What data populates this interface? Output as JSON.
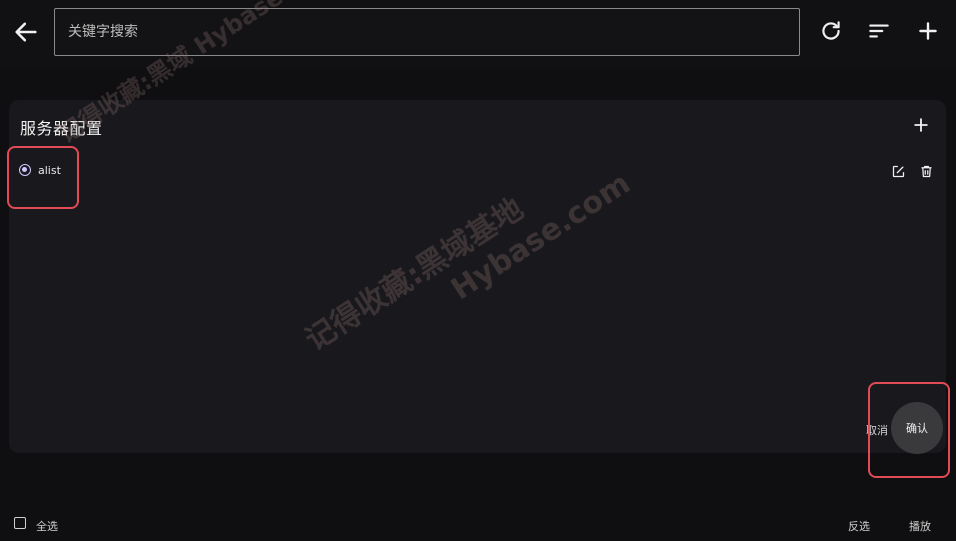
{
  "toolbar": {
    "search_placeholder": "关键字搜索"
  },
  "dialog": {
    "title": "服务器配置",
    "servers": [
      {
        "label": "alist",
        "selected": true
      }
    ],
    "cancel_label": "取消",
    "confirm_label": "确认"
  },
  "bottom": {
    "select_all_label": "全选",
    "invert_label": "反选",
    "play_label": "播放"
  },
  "watermark": {
    "line1": "记得收藏:黑域基地",
    "line2": "Hybase.com",
    "line3": "记得收藏:黑域 Hybase"
  },
  "colors": {
    "highlight": "#e04b55",
    "radio_accent": "#cfc8ff",
    "dialog_bg": "#19191d"
  },
  "icons": [
    "back-arrow-icon",
    "refresh-icon",
    "sort-icon",
    "add-icon",
    "edit-icon",
    "delete-icon"
  ]
}
